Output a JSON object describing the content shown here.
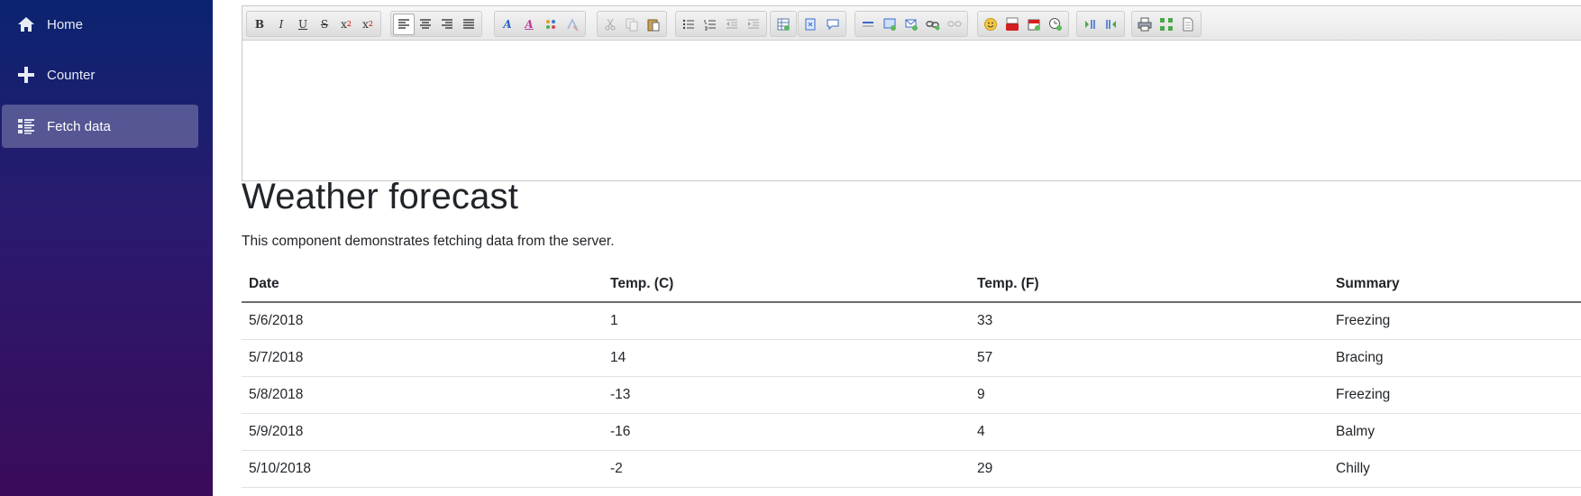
{
  "sidebar": {
    "items": [
      {
        "label": "Home",
        "icon": "home-icon"
      },
      {
        "label": "Counter",
        "icon": "plus-icon"
      },
      {
        "label": "Fetch data",
        "icon": "list-icon",
        "active": true
      }
    ],
    "colors": {
      "top": "#0b2470",
      "bottom": "#3a0b5a",
      "active_bg": "rgba(255,255,255,0.25)"
    }
  },
  "editor": {
    "toolbar": {
      "bold": "B",
      "italic": "I",
      "underline": "U",
      "strike": "S",
      "subscript": "x",
      "subscript_mark": "2",
      "superscript": "x",
      "superscript_mark": "2",
      "text_color": "A",
      "bg_color": "A"
    }
  },
  "page": {
    "title": "Weather forecast",
    "description": "This component demonstrates fetching data from the server."
  },
  "table": {
    "headers": [
      "Date",
      "Temp. (C)",
      "Temp. (F)",
      "Summary"
    ],
    "rows": [
      [
        "5/6/2018",
        "1",
        "33",
        "Freezing"
      ],
      [
        "5/7/2018",
        "14",
        "57",
        "Bracing"
      ],
      [
        "5/8/2018",
        "-13",
        "9",
        "Freezing"
      ],
      [
        "5/9/2018",
        "-16",
        "4",
        "Balmy"
      ],
      [
        "5/10/2018",
        "-2",
        "29",
        "Chilly"
      ]
    ]
  }
}
